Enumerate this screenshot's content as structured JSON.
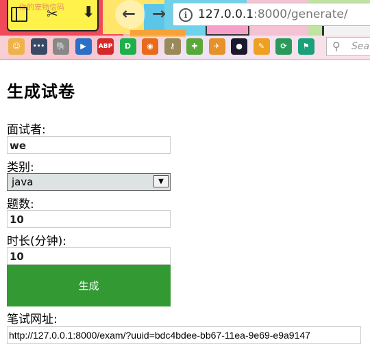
{
  "browser": {
    "url_host": "127.0.0.1",
    "url_rest": ":8000/generate/",
    "search_placeholder": "Sea",
    "theme_caption": "你的宠物信码",
    "extensions": [
      {
        "name": "baby-face-icon",
        "color": "#f0b24a",
        "glyph": "☺"
      },
      {
        "name": "more-dots-icon",
        "color": "#3a4a66",
        "glyph": "•••"
      },
      {
        "name": "evernote-icon",
        "color": "#888888",
        "glyph": "🐘"
      },
      {
        "name": "play-icon",
        "color": "#2a6fc8",
        "glyph": "▶"
      },
      {
        "name": "adblock-plus-icon",
        "color": "#d42a2a",
        "glyph": "ABP"
      },
      {
        "name": "idm-icon",
        "color": "#1fb04a",
        "glyph": "D"
      },
      {
        "name": "firefox-icon",
        "color": "#e86a1a",
        "glyph": "◉"
      },
      {
        "name": "key-icon",
        "color": "#9a8a5a",
        "glyph": "⚷"
      },
      {
        "name": "puzzle-icon",
        "color": "#5aa83a",
        "glyph": "✚"
      },
      {
        "name": "bird-icon",
        "color": "#e6912a",
        "glyph": "✈"
      },
      {
        "name": "ninja-icon",
        "color": "#1a1a2a",
        "glyph": "●"
      },
      {
        "name": "pencil-icon",
        "color": "#f0a020",
        "glyph": "✎"
      },
      {
        "name": "sync-icon",
        "color": "#2a9a5a",
        "glyph": "⟳"
      },
      {
        "name": "flag-icon",
        "color": "#1aa07a",
        "glyph": "⚑"
      }
    ]
  },
  "page": {
    "title": "生成试卷",
    "interviewer_label": "面试者:",
    "interviewer_value": "we",
    "category_label": "类别:",
    "category_value": "java",
    "count_label": "题数:",
    "count_value": "10",
    "duration_label": "时长(分钟):",
    "duration_value": "10",
    "generate_button": "生成",
    "exam_url_label": "笔试网址:",
    "exam_url_value": "http://127.0.0.1:8000/exam/?uuid=bdc4bdee-bb67-11ea-9e69-e9a9147"
  },
  "colors": {
    "button_green": "#339933",
    "select_bg": "#dde2e2"
  }
}
